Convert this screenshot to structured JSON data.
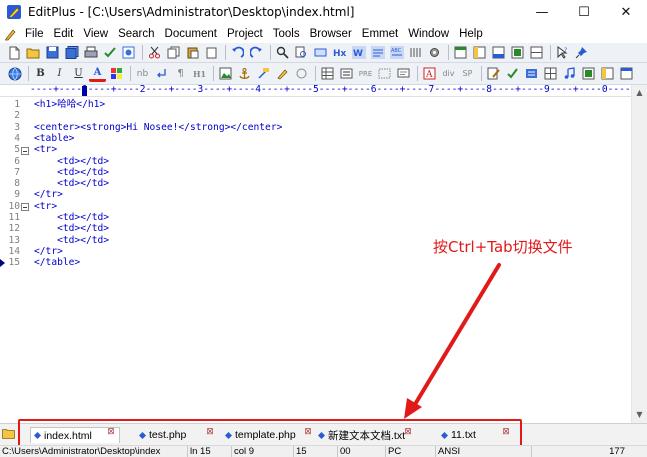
{
  "window": {
    "title": "EditPlus - [C:\\Users\\Administrator\\Desktop\\index.html]",
    "minimize_glyph": "—",
    "maximize_glyph": "☐",
    "close_glyph": "✕"
  },
  "menu": {
    "items": [
      "File",
      "Edit",
      "View",
      "Search",
      "Document",
      "Project",
      "Tools",
      "Browser",
      "Emmet",
      "Window",
      "Help"
    ]
  },
  "toolbar2": {
    "bold": "B",
    "italic": "I",
    "underline": "U",
    "font_color": "A",
    "nb": "nb",
    "para": "¶",
    "heading": "H1",
    "pre": "PRE",
    "div": "div",
    "sp": "SP"
  },
  "ruler": {
    "text": "----+----1----+----2----+----3----+----4----+----5----+----6----+----7----+----8----+----9----+----0----+"
  },
  "editor": {
    "lines": [
      {
        "n": "1",
        "text": "<h1>哈哈</h1>"
      },
      {
        "n": "2",
        "text": ""
      },
      {
        "n": "3",
        "text": "<center><strong>Hi Nosee!</strong></center>"
      },
      {
        "n": "4",
        "text": "<table>"
      },
      {
        "n": "5",
        "text": "<tr>"
      },
      {
        "n": "6",
        "text": "    <td></td>"
      },
      {
        "n": "7",
        "text": "    <td></td>"
      },
      {
        "n": "8",
        "text": "    <td></td>"
      },
      {
        "n": "9",
        "text": "</tr>"
      },
      {
        "n": "10",
        "text": "<tr>"
      },
      {
        "n": "11",
        "text": "    <td></td>"
      },
      {
        "n": "12",
        "text": "    <td></td>"
      },
      {
        "n": "13",
        "text": "    <td></td>"
      },
      {
        "n": "14",
        "text": "</tr>"
      },
      {
        "n": "15",
        "text": "</table>"
      }
    ]
  },
  "annotation": {
    "text": "按Ctrl+Tab切换文件",
    "color": "#e11919"
  },
  "tabs": [
    {
      "label": "index.html",
      "active": true
    },
    {
      "label": "test.php",
      "active": false
    },
    {
      "label": "template.php",
      "active": false
    },
    {
      "label": "新建文本文档.txt",
      "active": false
    },
    {
      "label": "11.txt",
      "active": false
    }
  ],
  "status": {
    "path": "C:\\Users\\Administrator\\Desktop\\index",
    "line": "ln 15",
    "col": "col 9",
    "num1": "15",
    "num2": "00",
    "mode": "PC",
    "encoding": "ANSI",
    "size": "177"
  },
  "colors": {
    "tag": "#0000cc",
    "line_number": "#808080",
    "accent_red": "#e11919"
  }
}
